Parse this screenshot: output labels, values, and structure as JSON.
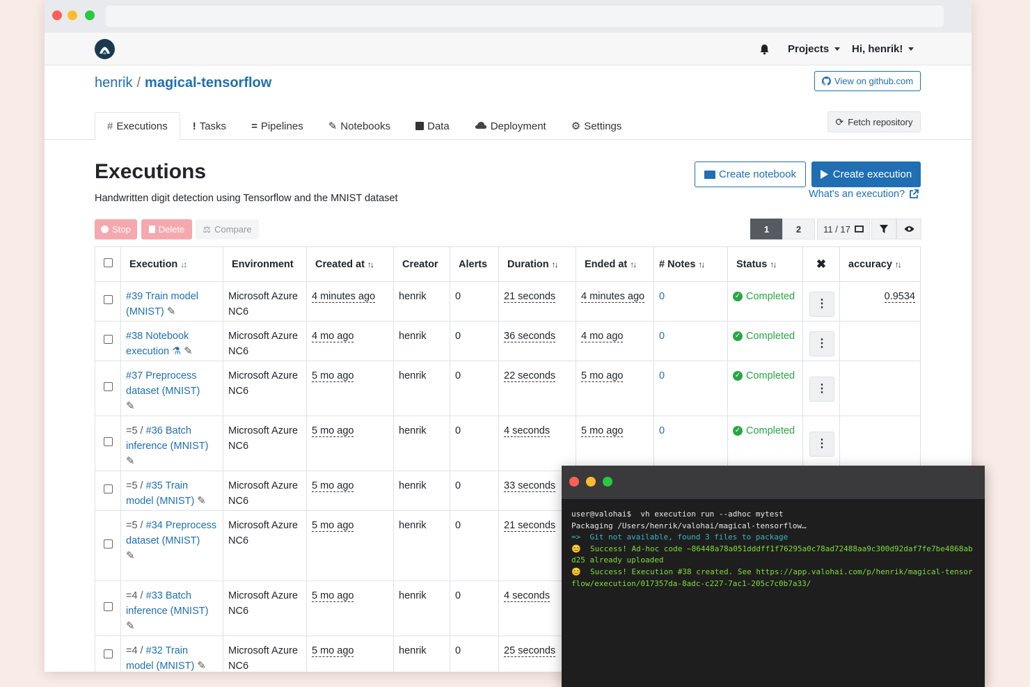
{
  "nav": {
    "projects": "Projects",
    "user": "Hi, henrik!"
  },
  "breadcrumb": {
    "owner": "henrik",
    "sep": "/",
    "repo": "magical-tensorflow"
  },
  "github_button": "View on github.com",
  "fetch_button": "Fetch repository",
  "tabs": [
    "Executions",
    "Tasks",
    "Pipelines",
    "Notebooks",
    "Data",
    "Deployment",
    "Settings"
  ],
  "page": {
    "title": "Executions",
    "description": "Handwritten digit detection using Tensorflow and the MNIST dataset",
    "create_notebook": "Create notebook",
    "create_execution": "Create execution",
    "help_link": "What's an execution?"
  },
  "actions": {
    "stop": "Stop",
    "delete": "Delete",
    "compare": "Compare"
  },
  "pager": {
    "page1": "1",
    "page2": "2",
    "columns": "11 / 17"
  },
  "columns": [
    "Execution",
    "Environment",
    "Created at",
    "Creator",
    "Alerts",
    "Duration",
    "Ended at",
    "# Notes",
    "Status",
    "accuracy"
  ],
  "rows": [
    {
      "prefix": "",
      "name": "#39 Train model (MNIST)",
      "env": "Microsoft Azure NC6",
      "created": "4 minutes ago",
      "creator": "henrik",
      "alerts": "0",
      "duration": "21 seconds",
      "ended": "4 minutes ago",
      "notes": "0",
      "status": "Completed",
      "accuracy": "0.9534"
    },
    {
      "prefix": "",
      "name": "#38 Notebook execution",
      "env": "Microsoft Azure NC6",
      "created": "4 mo ago",
      "creator": "henrik",
      "alerts": "0",
      "duration": "36 seconds",
      "ended": "4 mo ago",
      "notes": "0",
      "status": "Completed",
      "accuracy": ""
    },
    {
      "prefix": "",
      "name": "#37 Preprocess dataset (MNIST)",
      "env": "Microsoft Azure NC6",
      "created": "5 mo ago",
      "creator": "henrik",
      "alerts": "0",
      "duration": "22 seconds",
      "ended": "5 mo ago",
      "notes": "0",
      "status": "Completed",
      "accuracy": ""
    },
    {
      "prefix": "=5 / ",
      "name": "#36 Batch inference (MNIST)",
      "env": "Microsoft Azure NC6",
      "created": "5 mo ago",
      "creator": "henrik",
      "alerts": "0",
      "duration": "4 seconds",
      "ended": "5 mo ago",
      "notes": "0",
      "status": "Completed",
      "accuracy": ""
    },
    {
      "prefix": "=5 / ",
      "name": "#35 Train model (MNIST)",
      "env": "Microsoft Azure NC6",
      "created": "5 mo ago",
      "creator": "henrik",
      "alerts": "0",
      "duration": "33 seconds",
      "ended": "",
      "notes": "",
      "status": "",
      "accuracy": ""
    },
    {
      "prefix": "=5 / ",
      "name": "#34 Preprocess dataset (MNIST)",
      "env": "Microsoft Azure NC6",
      "created": "5 mo ago",
      "creator": "henrik",
      "alerts": "0",
      "duration": "21 seconds",
      "ended": "",
      "notes": "",
      "status": "",
      "accuracy": ""
    },
    {
      "prefix": "=4 / ",
      "name": "#33 Batch inference (MNIST)",
      "env": "Microsoft Azure NC6",
      "created": "5 mo ago",
      "creator": "henrik",
      "alerts": "0",
      "duration": "4 seconds",
      "ended": "",
      "notes": "",
      "status": "",
      "accuracy": ""
    },
    {
      "prefix": "=4 / ",
      "name": "#32 Train model (MNIST)",
      "env": "Microsoft Azure NC6",
      "created": "5 mo ago",
      "creator": "henrik",
      "alerts": "0",
      "duration": "25 seconds",
      "ended": "",
      "notes": "",
      "status": "",
      "accuracy": ""
    }
  ],
  "terminal": {
    "prompt": "user@valohai$",
    "command": "vh execution run --adhoc mytest",
    "line1": "Packaging /Users/henrik/valohai/magical-tensorflow…",
    "line2": "=>  Git not available, found 3 files to package",
    "line3": "😊  Success! Ad-hoc code ~86448a78a051dddff1f76295a0c78ad72488aa9c300d92daf7fe7be4868abd25 already uploaded",
    "line4": "😊  Success! Execution #38 created. See https://app.valohai.com/p/henrik/magical-tensorflow/execution/017357da-8adc-c227-7ac1-205c7c0b7a33/"
  },
  "colors": {
    "accent": "#1f6fb2",
    "success": "#28a745",
    "terminal_bg": "#1e1e1e"
  }
}
